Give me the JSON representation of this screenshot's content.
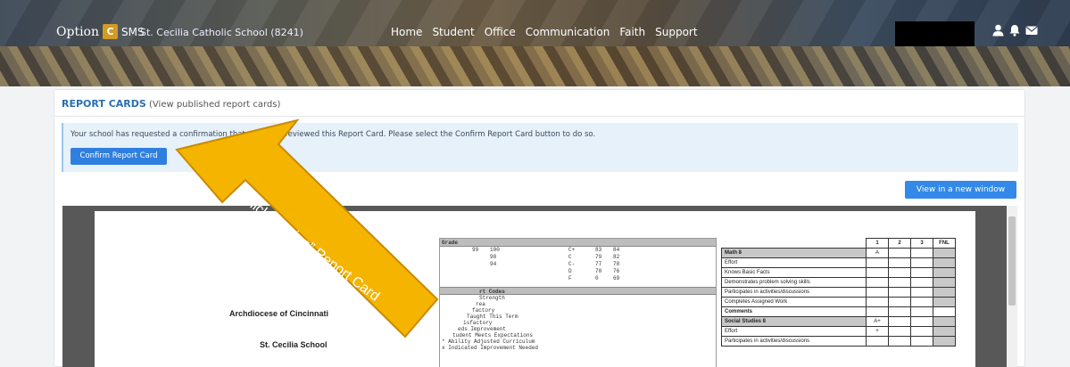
{
  "header": {
    "logo_text_left": "Option",
    "logo_box": "C",
    "logo_text_right": "SMS",
    "school": "St. Cecilia Catholic School (8241)",
    "nav": [
      "Home",
      "Student",
      "Office",
      "Communication",
      "Faith",
      "Support"
    ],
    "icons": [
      "user-icon",
      "bell-icon",
      "envelope-icon"
    ]
  },
  "panel": {
    "title": "REPORT CARDS",
    "subtitle": "(View published report cards)",
    "alert_text": "Your school has requested a confirmation that you have reviewed this Report Card. Please select the Confirm Report Card button to do so.",
    "confirm_button": "Confirm Report Card",
    "view_button": "View in a new window"
  },
  "report_card": {
    "diocese": "Archdiocese of Cincinnati",
    "school": "St. Cecilia School",
    "grade_header": "Grade",
    "grade_rows": [
      {
        "a": "",
        "b": "99",
        "c": "100",
        "d": "C+",
        "e": "83",
        "f": "84"
      },
      {
        "a": "",
        "b": "",
        "c": "98",
        "d": "C",
        "e": "79",
        "f": "82"
      },
      {
        "a": "",
        "b": "",
        "c": "94",
        "d": "C-",
        "e": "77",
        "f": "78"
      },
      {
        "a": "",
        "b": "",
        "c": "",
        "d": "D",
        "e": "70",
        "f": "76"
      },
      {
        "a": "",
        "b": "",
        "c": "",
        "d": "F",
        "e": "0",
        "f": "69"
      }
    ],
    "codes_header": "rt Codes",
    "codes": [
      "Strength",
      "rea",
      "factory",
      "Taught This Term",
      "isfactory",
      "eds Improvement",
      "tudent Meets Expectations",
      "* Ability Adjusted Curriculum",
      "x Indicated Improvement Needed"
    ],
    "columns": [
      "1",
      "2",
      "3",
      "FNL"
    ],
    "rows": [
      {
        "label": "Math 8",
        "kind": "subject",
        "vals": [
          "A",
          "",
          "",
          ""
        ]
      },
      {
        "label": "Effort",
        "kind": "item",
        "vals": [
          "",
          "",
          "",
          ""
        ]
      },
      {
        "label": "Knows Basic Facts",
        "kind": "item",
        "vals": [
          "",
          "",
          "",
          ""
        ]
      },
      {
        "label": "Demonstrates problem solving skills",
        "kind": "item",
        "vals": [
          "",
          "",
          "",
          ""
        ]
      },
      {
        "label": "Participates in activities/discussions",
        "kind": "item",
        "vals": [
          "",
          "",
          "",
          ""
        ]
      },
      {
        "label": "Completes Assigned Work",
        "kind": "item",
        "vals": [
          "",
          "",
          "",
          ""
        ]
      },
      {
        "label": "Comments",
        "kind": "comments",
        "vals": [
          "",
          "",
          "",
          ""
        ]
      },
      {
        "label": "Social Studies 8",
        "kind": "subject",
        "vals": [
          "A+",
          "",
          "",
          ""
        ]
      },
      {
        "label": "Effort",
        "kind": "item",
        "vals": [
          "+",
          "",
          "",
          ""
        ]
      },
      {
        "label": "Participates in activities/discussions",
        "kind": "item",
        "vals": [
          "",
          "",
          "",
          ""
        ]
      }
    ]
  },
  "annotation": {
    "text": "Click to “sign” Report Card",
    "color": "#f5b400"
  }
}
